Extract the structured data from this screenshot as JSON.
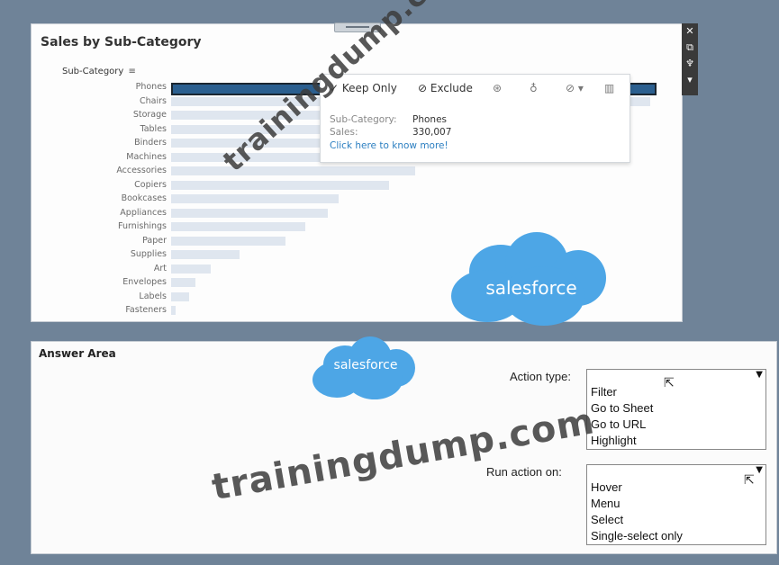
{
  "chart": {
    "title": "Sales by Sub-Category",
    "subcat_header": "Sub-Category",
    "filter_icon": "≡",
    "labels": [
      "Phones",
      "Chairs",
      "Storage",
      "Tables",
      "Binders",
      "Machines",
      "Accessories",
      "Copiers",
      "Bookcases",
      "Appliances",
      "Furnishings",
      "Paper",
      "Supplies",
      "Art",
      "Envelopes",
      "Labels",
      "Fasteners"
    ]
  },
  "chart_data": {
    "type": "bar",
    "title": "Sales by Sub-Category",
    "categories": [
      "Phones",
      "Chairs",
      "Storage",
      "Tables",
      "Binders",
      "Machines",
      "Accessories",
      "Copiers",
      "Bookcases",
      "Appliances",
      "Furnishings",
      "Paper",
      "Supplies",
      "Art",
      "Envelopes",
      "Labels",
      "Fasteners"
    ],
    "values": [
      330007,
      328449,
      223844,
      206966,
      203413,
      189239,
      167380,
      149528,
      114880,
      107532,
      91705,
      78479,
      46674,
      27119,
      16476,
      12486,
      3024
    ],
    "highlight": "Phones"
  },
  "tooltip": {
    "keep_only": "✓ Keep Only",
    "exclude": "⊘ Exclude",
    "line1_label": "Sub-Category:",
    "line1_value": "Phones",
    "line2_label": "Sales:",
    "line2_value": "330,007",
    "link": "Click here to know more!"
  },
  "branding": {
    "logo_text": "salesforce",
    "watermark": "trainingdump.com",
    "logo_color": "#4da6e6"
  },
  "answer": {
    "title": "Answer Area",
    "action_type_label": "Action type:",
    "action_type_options": [
      "Filter",
      "Go to Sheet",
      "Go to URL",
      "Highlight"
    ],
    "run_action_label": "Run action on:",
    "run_action_options": [
      "Hover",
      "Menu",
      "Select",
      "Single-select only"
    ]
  }
}
